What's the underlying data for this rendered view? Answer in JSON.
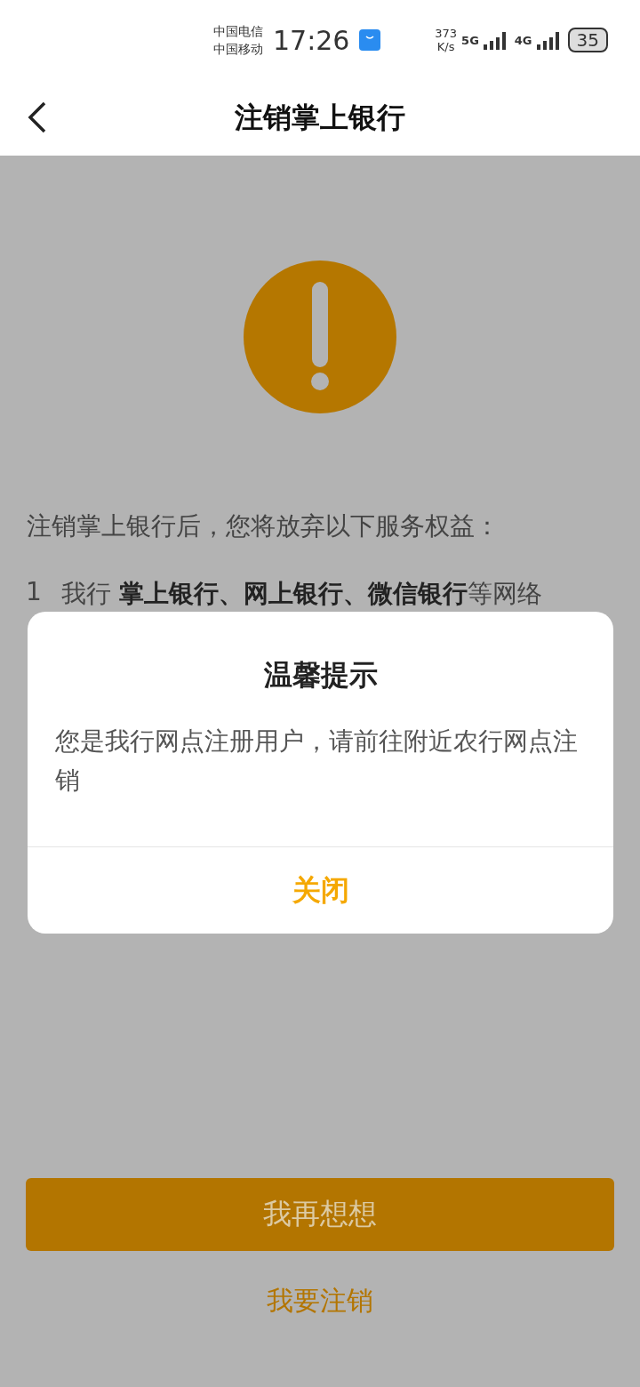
{
  "status_bar": {
    "carrier_1": "中国电信",
    "carrier_2": "中国移动",
    "time": "17:26",
    "speed_value": "373",
    "speed_unit": "K/s",
    "network_1": "5G",
    "network_2": "4G",
    "battery": "35"
  },
  "header": {
    "title": "注销掌上银行"
  },
  "content": {
    "intro": "注销掌上银行后，您将放弃以下服务权益：",
    "items": [
      {
        "number": "1",
        "text": "我行 **掌上银行、网上银行、微信银行**等网络"
      }
    ]
  },
  "buttons": [
    {
      "kind": "primary",
      "label": "我再想想"
    },
    {
      "kind": "link",
      "label": "我要注销"
    }
  ],
  "dialog": {
    "title": "温馨提示",
    "message": "您是我行网点注册用户，请前往附近农行网点注销",
    "button": "关闭"
  }
}
